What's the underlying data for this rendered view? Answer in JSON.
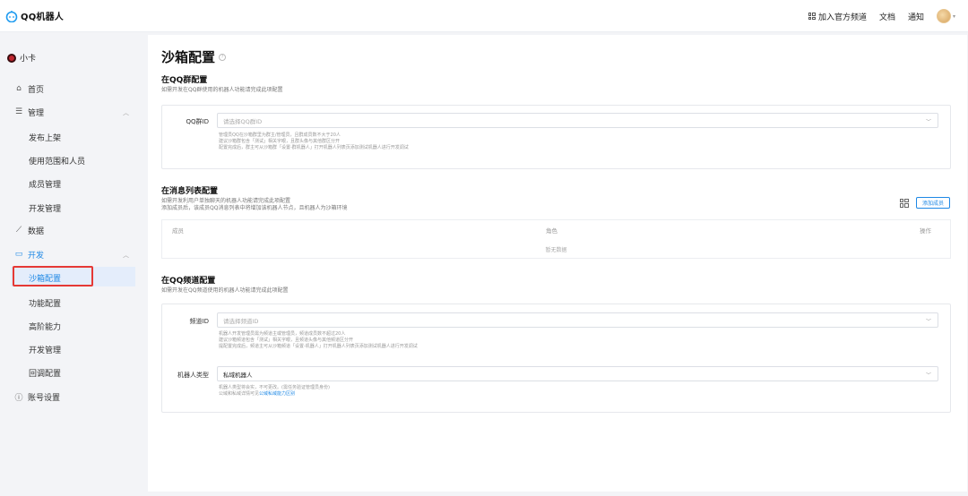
{
  "header": {
    "app_name": "QQ机器人",
    "channel_label": "加入官方频道",
    "docs_label": "文档",
    "notify_label": "通知"
  },
  "sidebar": {
    "bot_name": "小卡",
    "items": {
      "home": "首页",
      "manage": "管理",
      "publish": "发布上架",
      "scope": "使用范围和人员",
      "members": "成员管理",
      "devmanage": "开发管理",
      "data": "数据",
      "dev": "开发",
      "sandbox": "沙箱配置",
      "features": "功能配置",
      "advanced": "高阶能力",
      "devmanage2": "开发管理",
      "callback": "回调配置",
      "account": "账号设置"
    }
  },
  "main": {
    "title": "沙箱配置",
    "group": {
      "title": "在QQ群配置",
      "desc": "如需开发在QQ群使用的机器人功能请完成此项配置",
      "label": "QQ群ID",
      "placeholder": "请选择QQ群ID",
      "hint1": "管理员QQ在沙箱群里为群主/管理员，且群成员数不大于20人",
      "hint2": "建议沙箱群包含「测试」相关字眼，且群头像与其他群区分开",
      "hint3": "配置完成后，群主可从沙箱群「设置-群机器人」打开机器人列表页添加测试机器人进行开发调试"
    },
    "message": {
      "title": "在消息列表配置",
      "desc1": "如需开发利用户单独聊天的机器人功能请完成此项配置",
      "desc2": "添加成员后，该成员QQ消息列表中将增加该机器人节点，且机器人为沙箱环境",
      "add_button": "添加成员",
      "col_member": "成员",
      "col_role": "角色",
      "col_action": "操作",
      "empty": "暂无数据"
    },
    "channel": {
      "title": "在QQ频道配置",
      "desc": "如需开发在QQ频道使用的机器人功能请完成此项配置",
      "label": "频道ID",
      "placeholder": "请选择频道ID",
      "hint1": "机器人开发管理员需为频道主或管理员，频道成员数不超过20人",
      "hint2": "建议沙箱频道包含「测试」相关字眼，且频道头像与其他频道区分开",
      "hint3": "提配置完成后，频道主可从沙箱频道「设置-机器人」打开机器人列表页添加测试机器人进行开发调试",
      "type_label": "机器人类型",
      "type_value": "私域机器人",
      "type_hint1": "机器人类型将会实，不可更改。(需任务验证管理员身份)",
      "type_hint2_prefix": "公域和私域详情可见",
      "type_hint2_link": "公域私域能力区别"
    }
  }
}
